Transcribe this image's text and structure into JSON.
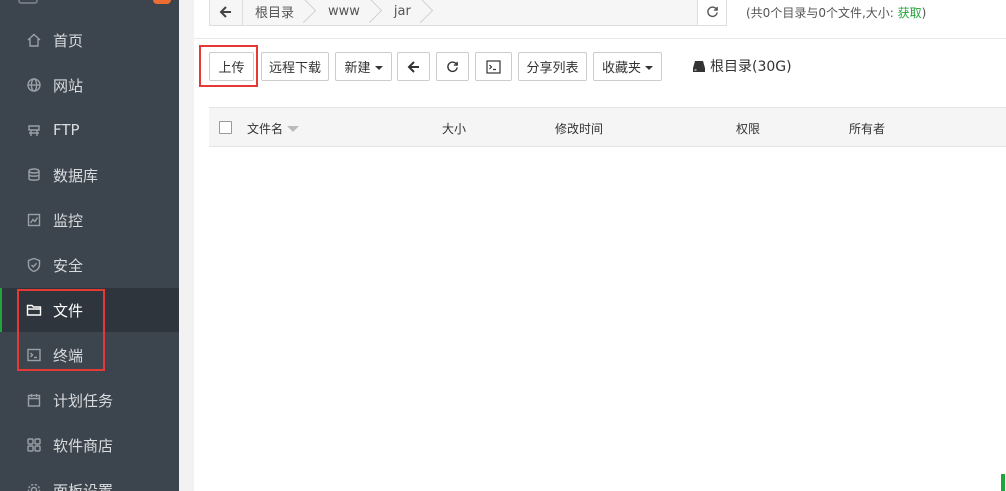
{
  "sidebar": {
    "items": [
      {
        "label": "首页",
        "icon": "home-icon"
      },
      {
        "label": "网站",
        "icon": "globe-icon"
      },
      {
        "label": "FTP",
        "icon": "ftp-icon"
      },
      {
        "label": "数据库",
        "icon": "database-icon"
      },
      {
        "label": "监控",
        "icon": "monitor-icon"
      },
      {
        "label": "安全",
        "icon": "shield-icon"
      },
      {
        "label": "文件",
        "icon": "folder-icon"
      },
      {
        "label": "终端",
        "icon": "terminal-icon"
      },
      {
        "label": "计划任务",
        "icon": "calendar-icon"
      },
      {
        "label": "软件商店",
        "icon": "apps-icon"
      },
      {
        "label": "面板设置",
        "icon": "settings-icon"
      }
    ],
    "active": "文件"
  },
  "breadcrumb": {
    "items": [
      "根目录",
      "www",
      "jar"
    ]
  },
  "summary": {
    "text": "(共0个目录与0个文件,大小: ",
    "link": "获取",
    "close": ")"
  },
  "toolbar": {
    "upload": "上传",
    "remote_download": "远程下载",
    "new": "新建",
    "share_list": "分享列表",
    "favorites": "收藏夹",
    "disk": "根目录(30G)"
  },
  "table": {
    "columns": [
      "文件名",
      "大小",
      "修改时间",
      "权限",
      "所有者"
    ]
  },
  "colors": {
    "sidebar_bg": "#3c444d",
    "accent": "#20a53a",
    "highlight": "#e53935"
  }
}
